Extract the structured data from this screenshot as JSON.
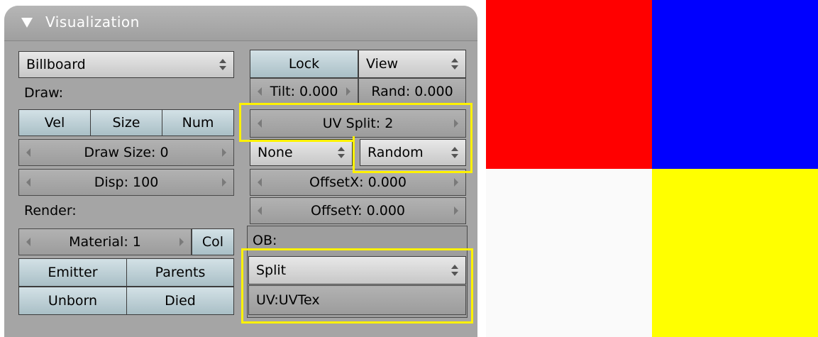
{
  "panel": {
    "title": "Visualization",
    "left": {
      "visualization_menu": "Billboard",
      "draw_label": "Draw:",
      "draw_buttons": [
        "Vel",
        "Size",
        "Num"
      ],
      "draw_size": "Draw Size: 0",
      "disp": "Disp: 100",
      "render_label": "Render:",
      "material": "Material: 1",
      "col_button": "Col",
      "emitter": "Emitter",
      "parents": "Parents",
      "unborn": "Unborn",
      "died": "Died"
    },
    "right": {
      "lock_button": "Lock",
      "view_menu": "View",
      "tilt": "Tilt: 0.000",
      "rand": "Rand: 0.000",
      "uv_split": "UV Split: 2",
      "none_menu": "None",
      "random_menu": "Random",
      "offset_x": "OffsetX: 0.000",
      "offset_y": "OffsetY: 0.000",
      "ob_label": "OB:",
      "split_menu": "Split",
      "uv_label": "UV:UVTex"
    }
  },
  "texture_preview": {
    "colors": [
      "#ff0000",
      "#0000ff",
      "#fafafa",
      "#ffff00"
    ]
  },
  "highlight_color": "#fff200"
}
